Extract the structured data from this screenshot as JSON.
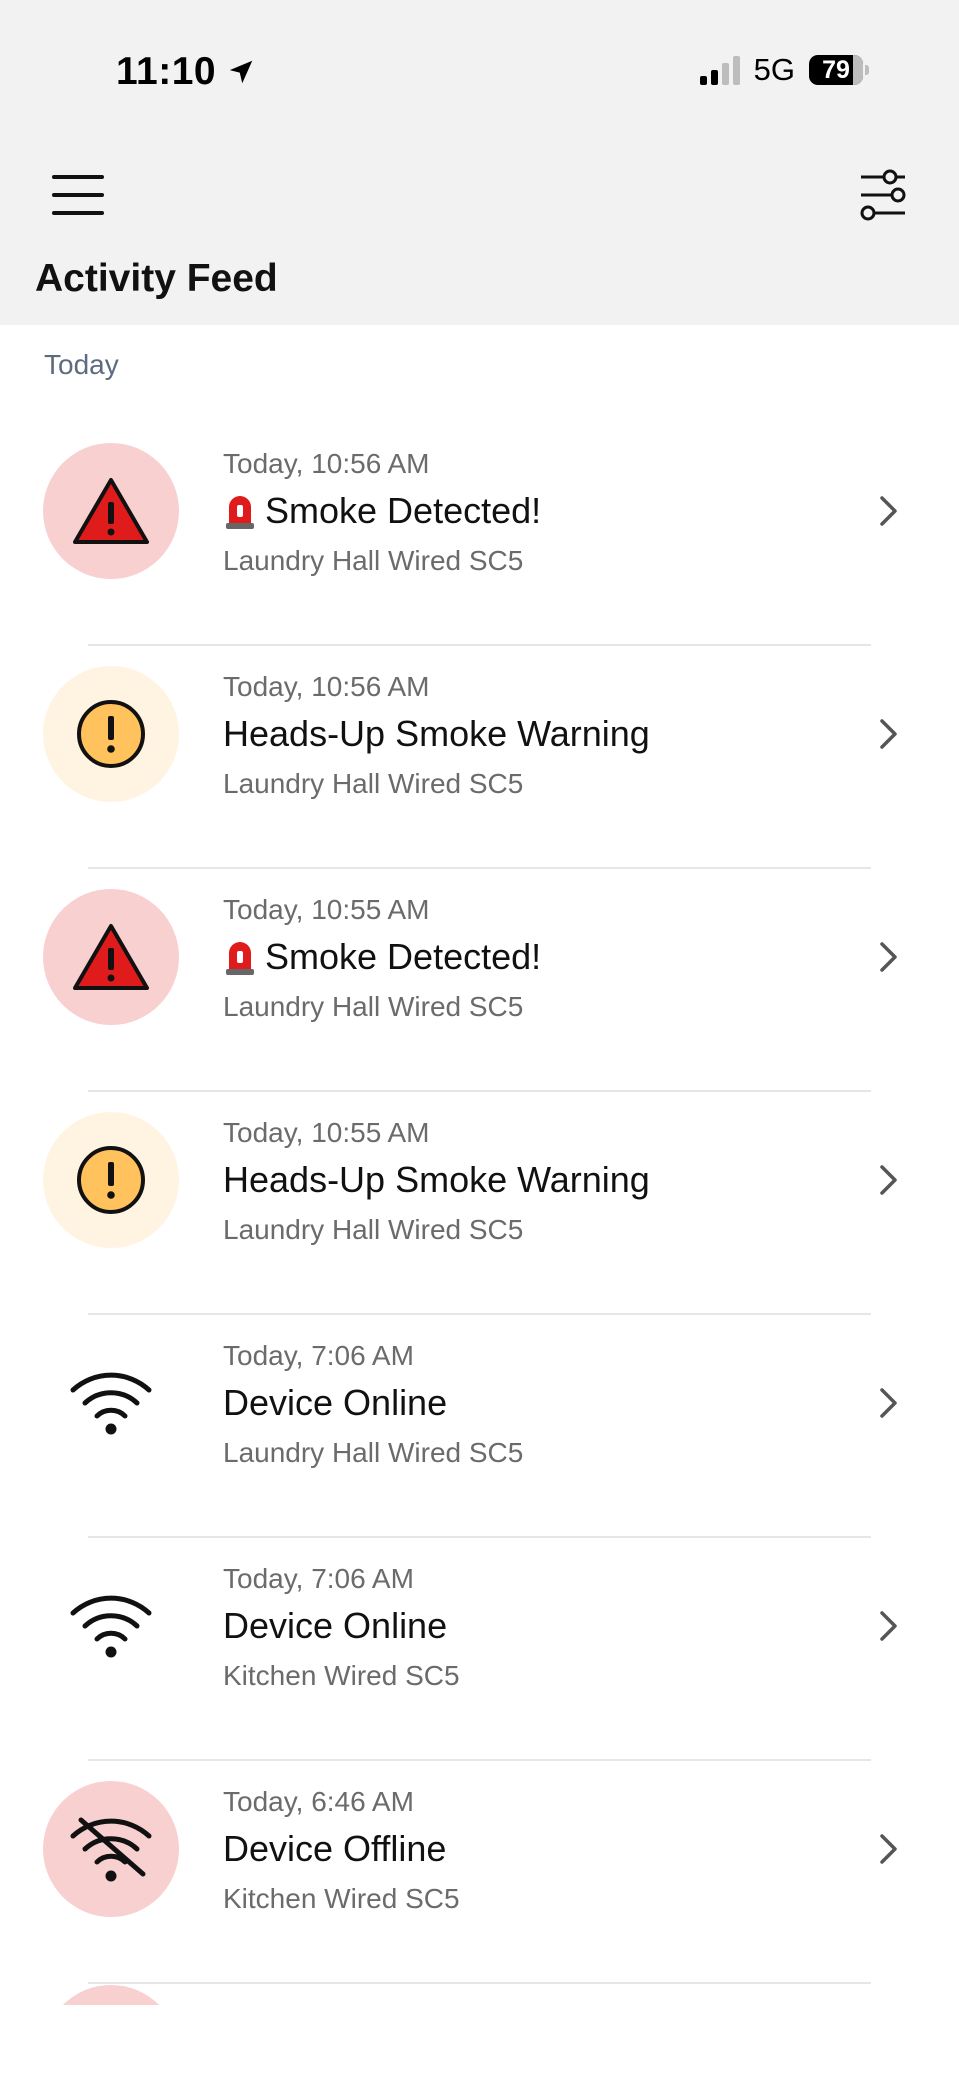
{
  "status_bar": {
    "time": "11:10",
    "network": "5G",
    "battery": "79"
  },
  "header": {
    "title": "Activity Feed"
  },
  "feed": {
    "section_label": "Today",
    "items": [
      {
        "time": "Today, 10:56 AM",
        "title": "Smoke Detected!",
        "device": "Laundry Hall Wired SC5",
        "icon": "alarm-triangle-icon",
        "emoji": "siren-icon"
      },
      {
        "time": "Today, 10:56 AM",
        "title": "Heads-Up Smoke Warning",
        "device": "Laundry Hall Wired SC5",
        "icon": "warning-circle-icon"
      },
      {
        "time": "Today, 10:55 AM",
        "title": "Smoke Detected!",
        "device": "Laundry Hall Wired SC5",
        "icon": "alarm-triangle-icon",
        "emoji": "siren-icon"
      },
      {
        "time": "Today, 10:55 AM",
        "title": "Heads-Up Smoke Warning",
        "device": "Laundry Hall Wired SC5",
        "icon": "warning-circle-icon"
      },
      {
        "time": "Today, 7:06 AM",
        "title": "Device Online",
        "device": "Laundry Hall Wired SC5",
        "icon": "wifi-icon"
      },
      {
        "time": "Today, 7:06 AM",
        "title": "Device Online",
        "device": "Kitchen Wired SC5",
        "icon": "wifi-icon"
      },
      {
        "time": "Today, 6:46 AM",
        "title": "Device Offline",
        "device": "Kitchen Wired SC5",
        "icon": "wifi-off-icon"
      }
    ]
  },
  "colors": {
    "alarm_bg": "#f8d0d0",
    "alarm_red": "#e01b1b",
    "warning_bg": "#fff4e2",
    "warning_yellow": "#ffc25c",
    "header_bg": "#f2f2f2",
    "section_label": "#5d6b80"
  }
}
